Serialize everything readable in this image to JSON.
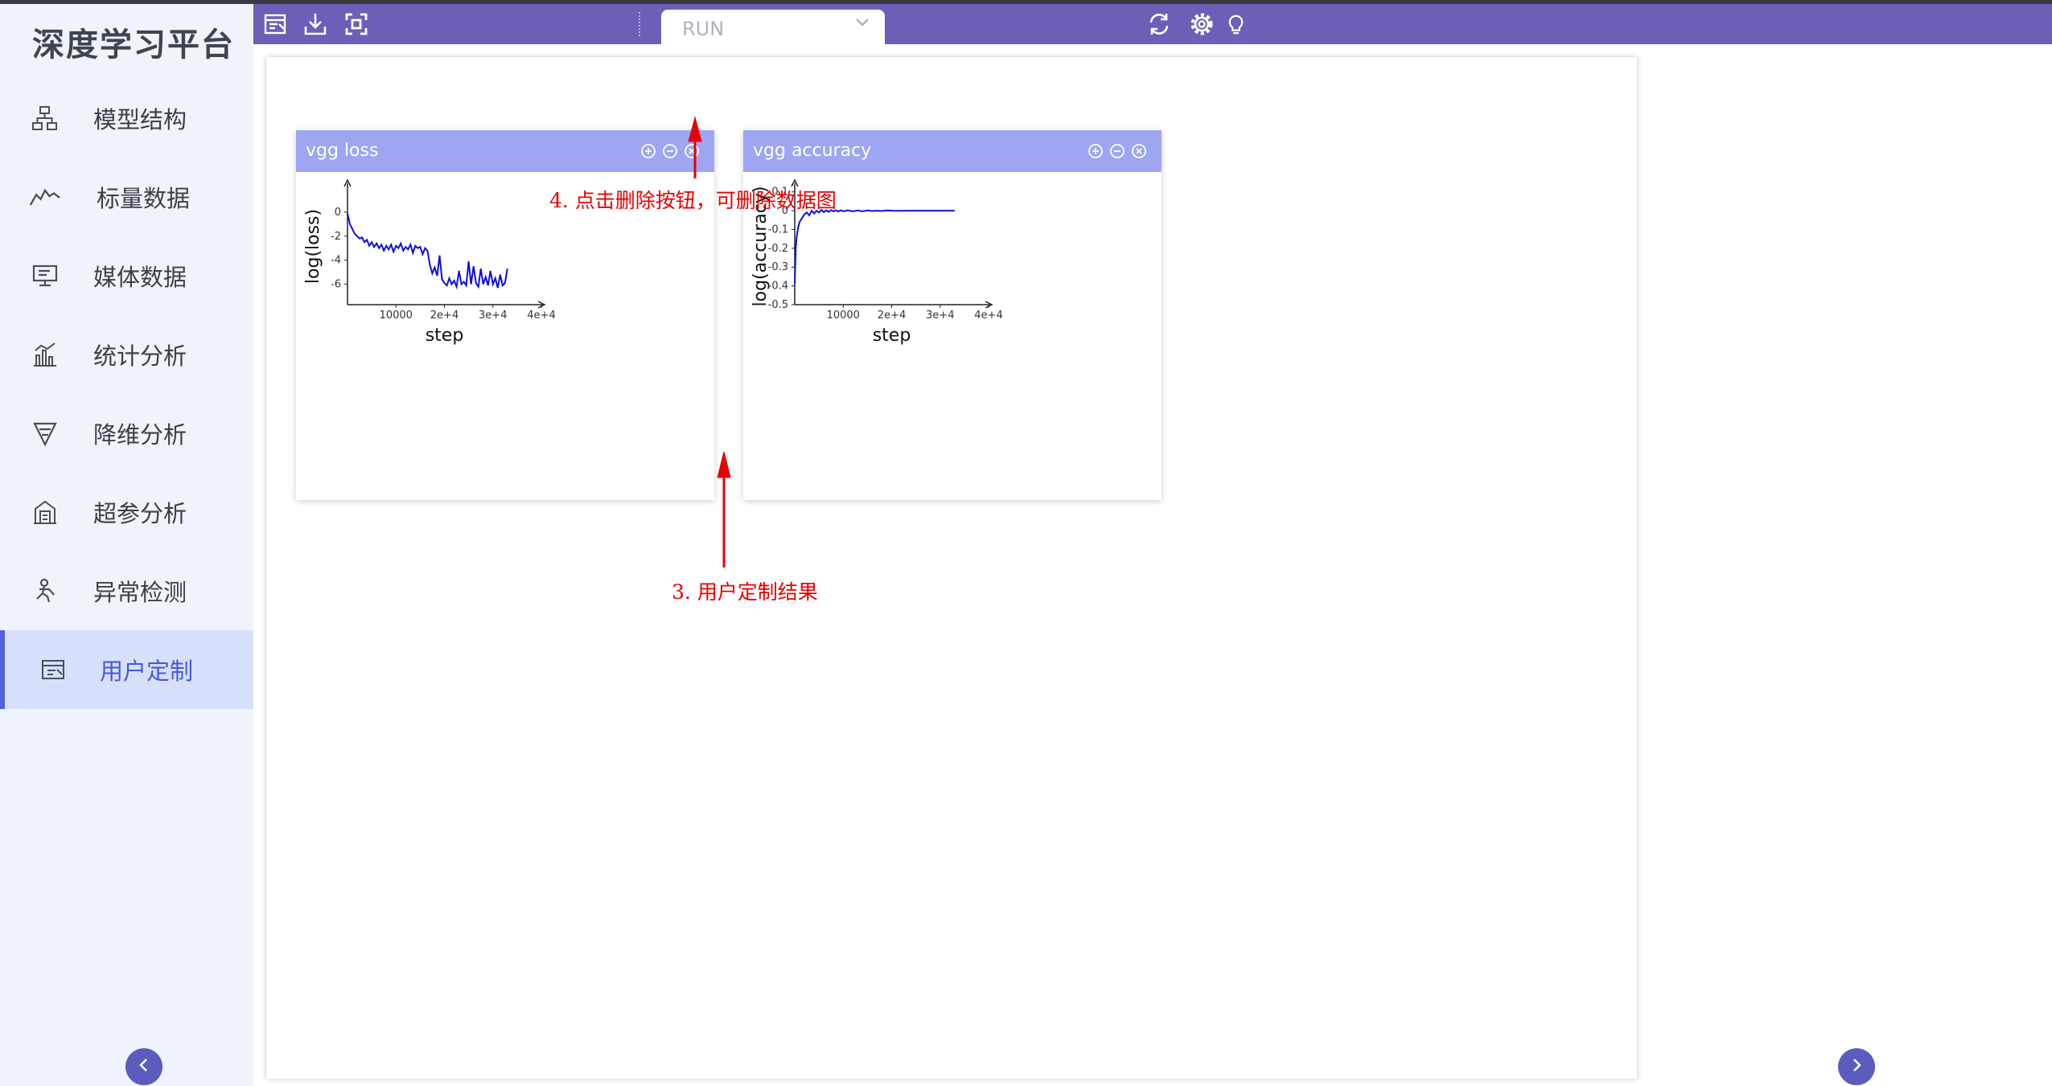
{
  "app": {
    "title": "深度学习平台"
  },
  "sidebar": {
    "items": [
      {
        "label": "模型结构",
        "icon": "model-structure-icon"
      },
      {
        "label": "标量数据",
        "icon": "scalar-line-icon"
      },
      {
        "label": "媒体数据",
        "icon": "media-monitor-icon"
      },
      {
        "label": "统计分析",
        "icon": "statistics-bar-icon"
      },
      {
        "label": "降维分析",
        "icon": "funnel-icon"
      },
      {
        "label": "超参分析",
        "icon": "hyperparam-icon"
      },
      {
        "label": "异常检测",
        "icon": "anomaly-person-icon"
      },
      {
        "label": "用户定制",
        "icon": "custom-edit-icon",
        "active": true
      }
    ]
  },
  "toolbar": {
    "run_placeholder": "RUN"
  },
  "cards": [
    {
      "title": "vgg loss",
      "ylabel": "log(loss)",
      "xlabel": "step"
    },
    {
      "title": "vgg accuracy",
      "ylabel": "log(accuracy)",
      "xlabel": "step"
    }
  ],
  "annotations": {
    "delete_hint": "4. 点击删除按钮，可删除数据图",
    "result_hint": "3. 用户定制结果"
  },
  "colors": {
    "accent": "#6b5fb8",
    "card_header": "#9ea6f3",
    "line": "#1010d8",
    "annotation": "#e80000"
  },
  "chart_data": [
    {
      "type": "line",
      "title": "vgg loss",
      "xlabel": "step",
      "ylabel": "log(loss)",
      "xlim": [
        0,
        40000
      ],
      "ylim": [
        -7.7,
        2.0
      ],
      "x_ticks": [
        "10000",
        "2e+4",
        "3e+4",
        "4e+4"
      ],
      "y_ticks": [
        "0",
        "-2",
        "-4",
        "-6"
      ],
      "series": [
        {
          "x": [
            0,
            500,
            1000,
            1500,
            2000,
            2500,
            3000,
            3500,
            4000,
            4500,
            5000,
            5500,
            6000,
            6500,
            7000,
            7500,
            8000,
            8500,
            9000,
            9500,
            10000,
            10500,
            11000,
            11500,
            12000,
            12500,
            13000,
            13500,
            14000,
            14500,
            15000,
            15500,
            16000,
            16500,
            17000,
            17500,
            18000,
            18500,
            19000,
            19500,
            20000,
            20500,
            21000,
            21500,
            22000,
            22500,
            23000,
            23500,
            24000,
            24500,
            25000,
            25500,
            26000,
            26500,
            27000,
            27500,
            28000,
            28500,
            29000,
            29500,
            30000,
            30500,
            31000,
            31500,
            32000,
            32500,
            33000
          ],
          "y": [
            -0.1,
            -1.0,
            -1.4,
            -1.8,
            -2.0,
            -2.2,
            -2.1,
            -2.5,
            -2.3,
            -2.8,
            -2.5,
            -2.9,
            -2.6,
            -3.0,
            -2.7,
            -3.2,
            -2.8,
            -3.1,
            -2.7,
            -3.3,
            -2.8,
            -3.0,
            -2.6,
            -3.2,
            -2.9,
            -3.1,
            -2.7,
            -3.4,
            -2.8,
            -3.0,
            -2.9,
            -3.5,
            -3.0,
            -3.2,
            -4.4,
            -5.1,
            -4.6,
            -5.3,
            -3.6,
            -5.6,
            -5.9,
            -6.1,
            -5.5,
            -6.0,
            -5.7,
            -6.2,
            -4.9,
            -6.0,
            -5.8,
            -6.1,
            -4.1,
            -6.0,
            -4.5,
            -5.9,
            -6.2,
            -4.7,
            -6.0,
            -5.4,
            -6.1,
            -4.9,
            -6.0,
            -5.5,
            -6.3,
            -5.2,
            -6.1,
            -5.9,
            -4.7
          ]
        }
      ]
    },
    {
      "type": "line",
      "title": "vgg accuracy",
      "xlabel": "step",
      "ylabel": "log(accuracy)",
      "xlim": [
        0,
        40000
      ],
      "ylim": [
        -0.5,
        0.12
      ],
      "x_ticks": [
        "10000",
        "2e+4",
        "3e+4",
        "4e+4"
      ],
      "y_ticks": [
        "0.1",
        "0",
        "-0.1",
        "-0.2",
        "-0.3",
        "-0.4",
        "-0.5"
      ],
      "series": [
        {
          "x": [
            0,
            200,
            400,
            700,
            1000,
            1500,
            2000,
            2500,
            3000,
            3500,
            4000,
            4500,
            5000,
            5500,
            6000,
            6500,
            7000,
            7500,
            8000,
            8500,
            9000,
            9500,
            10000,
            11000,
            12000,
            13000,
            14000,
            15000,
            16000,
            17000,
            18000,
            19000,
            20000,
            22000,
            24000,
            26000,
            28000,
            30000,
            32000,
            33000
          ],
          "y": [
            -0.39,
            -0.2,
            -0.14,
            -0.09,
            -0.06,
            -0.04,
            -0.02,
            -0.01,
            -0.025,
            0.0,
            -0.015,
            0.0,
            -0.01,
            0.004,
            -0.008,
            0.002,
            -0.006,
            0.003,
            -0.004,
            0.002,
            -0.005,
            0.002,
            -0.003,
            0.002,
            -0.004,
            0.001,
            -0.003,
            0.001,
            -0.002,
            0.0,
            -0.002,
            0.001,
            0.0,
            -0.001,
            0.0,
            0.0,
            0.0,
            0.0,
            0.0,
            0.0
          ]
        }
      ]
    }
  ]
}
